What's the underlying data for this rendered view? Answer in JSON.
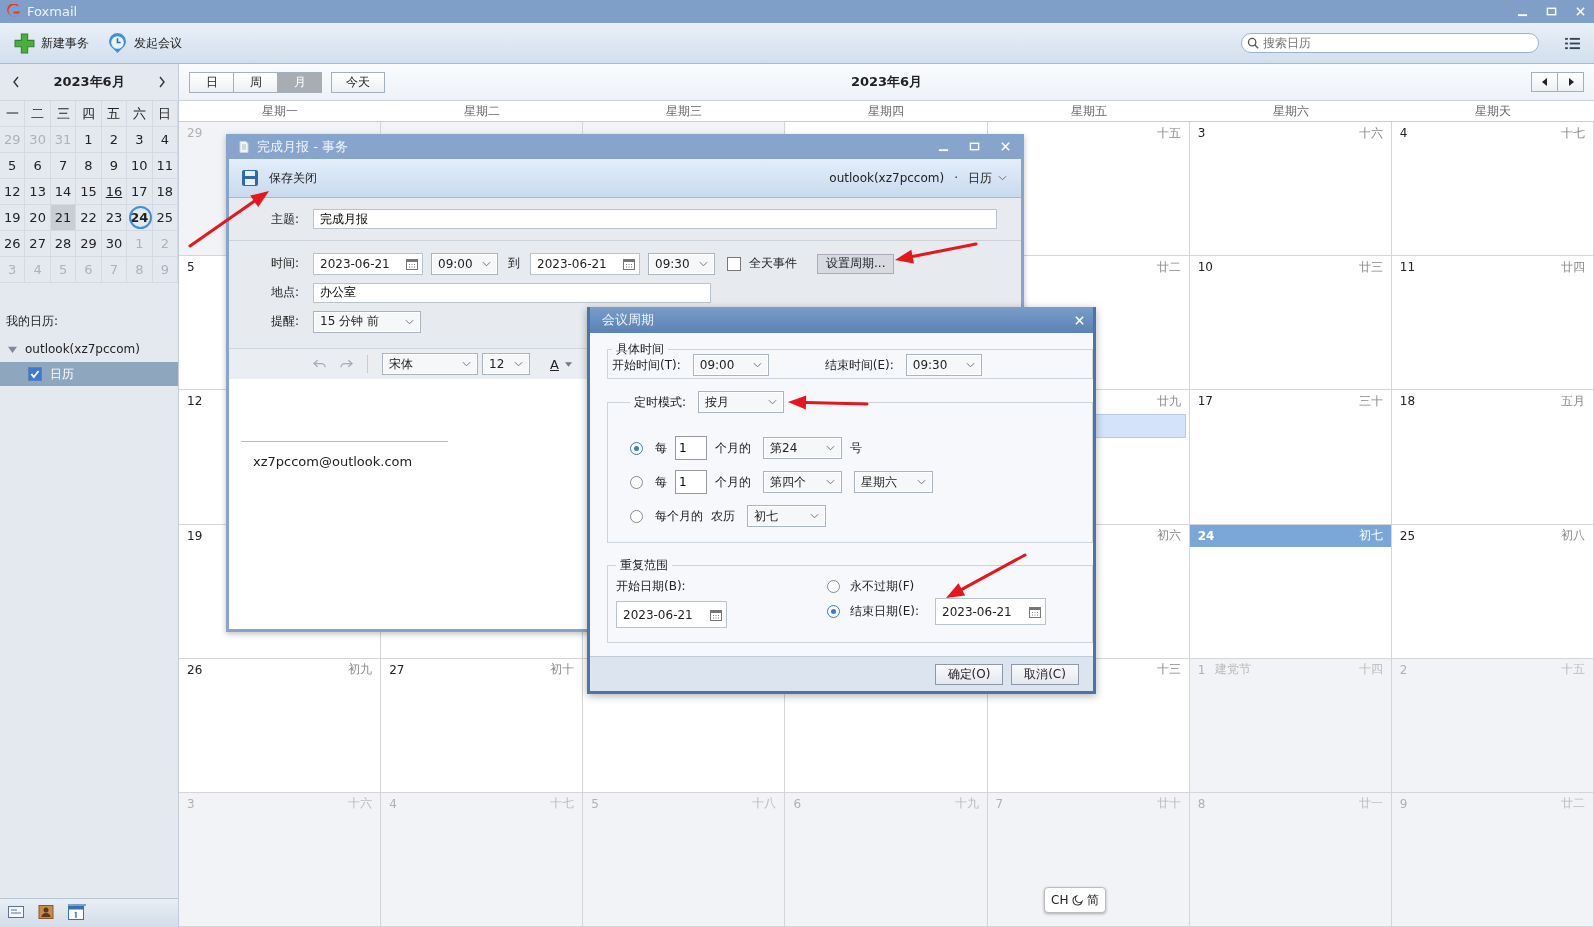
{
  "app": {
    "title": "Foxmail"
  },
  "toolbar": {
    "buttons": [
      {
        "kind": "new",
        "label": "新建事务"
      },
      {
        "kind": "meeting",
        "label": "发起会议"
      }
    ],
    "search": {
      "placeholder": "搜索日历"
    }
  },
  "mini_calendar": {
    "title": "2023年6月",
    "weekdays": [
      "一",
      "二",
      "三",
      "四",
      "五",
      "六",
      "日"
    ],
    "days": [
      {
        "d": "29",
        "other": true,
        "selected": false,
        "today": false,
        "event": false
      },
      {
        "d": "30",
        "other": true,
        "selected": false,
        "today": false,
        "event": false
      },
      {
        "d": "31",
        "other": true,
        "selected": false,
        "today": false,
        "event": false
      },
      {
        "d": "1",
        "other": false,
        "selected": false,
        "today": false,
        "event": false
      },
      {
        "d": "2",
        "other": false,
        "selected": false,
        "today": false,
        "event": false
      },
      {
        "d": "3",
        "other": false,
        "selected": false,
        "today": false,
        "event": false
      },
      {
        "d": "4",
        "other": false,
        "selected": false,
        "today": false,
        "event": false
      },
      {
        "d": "5",
        "other": false,
        "selected": false,
        "today": false,
        "event": false
      },
      {
        "d": "6",
        "other": false,
        "selected": false,
        "today": false,
        "event": false
      },
      {
        "d": "7",
        "other": false,
        "selected": false,
        "today": false,
        "event": false
      },
      {
        "d": "8",
        "other": false,
        "selected": false,
        "today": false,
        "event": false
      },
      {
        "d": "9",
        "other": false,
        "selected": false,
        "today": false,
        "event": false
      },
      {
        "d": "10",
        "other": false,
        "selected": false,
        "today": false,
        "event": false
      },
      {
        "d": "11",
        "other": false,
        "selected": false,
        "today": false,
        "event": false
      },
      {
        "d": "12",
        "other": false,
        "selected": false,
        "today": false,
        "event": false
      },
      {
        "d": "13",
        "other": false,
        "selected": false,
        "today": false,
        "event": false
      },
      {
        "d": "14",
        "other": false,
        "selected": false,
        "today": false,
        "event": false
      },
      {
        "d": "15",
        "other": false,
        "selected": false,
        "today": false,
        "event": false
      },
      {
        "d": "16",
        "other": false,
        "selected": false,
        "today": false,
        "event": true
      },
      {
        "d": "17",
        "other": false,
        "selected": false,
        "today": false,
        "event": false
      },
      {
        "d": "18",
        "other": false,
        "selected": false,
        "today": false,
        "event": false
      },
      {
        "d": "19",
        "other": false,
        "selected": false,
        "today": false,
        "event": false
      },
      {
        "d": "20",
        "other": false,
        "selected": false,
        "today": false,
        "event": false
      },
      {
        "d": "21",
        "other": false,
        "selected": true,
        "today": false,
        "event": false
      },
      {
        "d": "22",
        "other": false,
        "selected": false,
        "today": false,
        "event": false
      },
      {
        "d": "23",
        "other": false,
        "selected": false,
        "today": false,
        "event": false
      },
      {
        "d": "24",
        "other": false,
        "selected": false,
        "today": true,
        "event": false
      },
      {
        "d": "25",
        "other": false,
        "selected": false,
        "today": false,
        "event": false
      },
      {
        "d": "26",
        "other": false,
        "selected": false,
        "today": false,
        "event": false
      },
      {
        "d": "27",
        "other": false,
        "selected": false,
        "today": false,
        "event": false
      },
      {
        "d": "28",
        "other": false,
        "selected": false,
        "today": false,
        "event": false
      },
      {
        "d": "29",
        "other": false,
        "selected": false,
        "today": false,
        "event": false
      },
      {
        "d": "30",
        "other": false,
        "selected": false,
        "today": false,
        "event": false
      },
      {
        "d": "1",
        "other": true,
        "selected": false,
        "today": false,
        "event": false
      },
      {
        "d": "2",
        "other": true,
        "selected": false,
        "today": false,
        "event": false
      },
      {
        "d": "3",
        "other": true,
        "selected": false,
        "today": false,
        "event": false
      },
      {
        "d": "4",
        "other": true,
        "selected": false,
        "today": false,
        "event": false
      },
      {
        "d": "5",
        "other": true,
        "selected": false,
        "today": false,
        "event": false
      },
      {
        "d": "6",
        "other": true,
        "selected": false,
        "today": false,
        "event": false
      },
      {
        "d": "7",
        "other": true,
        "selected": false,
        "today": false,
        "event": false
      },
      {
        "d": "8",
        "other": true,
        "selected": false,
        "today": false,
        "event": false
      },
      {
        "d": "9",
        "other": true,
        "selected": false,
        "today": false,
        "event": false
      }
    ]
  },
  "my_calendars": {
    "heading": "我的日历:",
    "accounts": [
      {
        "name": "outlook(xz7pccom)",
        "expanded": true,
        "children": [
          {
            "name": "日历",
            "checked": true,
            "selected": true
          }
        ]
      }
    ]
  },
  "bottom_nav": [
    {
      "kind": "mail",
      "selected": false
    },
    {
      "kind": "contacts",
      "selected": false
    },
    {
      "kind": "calendar",
      "selected": true
    }
  ],
  "calendar": {
    "views": [
      {
        "label": "日",
        "selected": false
      },
      {
        "label": "周",
        "selected": false
      },
      {
        "label": "月",
        "selected": true
      }
    ],
    "today_button": "今天",
    "title": "2023年6月",
    "weekdays": [
      "星期一",
      "星期二",
      "星期三",
      "星期四",
      "星期五",
      "星期六",
      "星期天"
    ],
    "cells": [
      {
        "day": "29",
        "other_month": true,
        "today": false
      },
      {
        "other_month": true
      },
      {
        "other_month": true
      },
      {
        "other_month": false
      },
      {
        "lunar": "十五",
        "other_month": false,
        "today": false
      },
      {
        "day": "3",
        "lunar": "十六",
        "other_month": false,
        "today": false
      },
      {
        "day": "4",
        "lunar": "十七",
        "other_month": false,
        "today": false
      },
      {
        "day": "5",
        "other_month": false,
        "today": false
      },
      {},
      {},
      {},
      {
        "lunar": "廿二",
        "other_month": false,
        "today": false
      },
      {
        "day": "10",
        "lunar": "廿三",
        "other_month": false,
        "today": false
      },
      {
        "day": "11",
        "lunar": "廿四",
        "other_month": false,
        "today": false
      },
      {
        "day": "12",
        "other_month": false,
        "today": false
      },
      {},
      {},
      {},
      {
        "lunar": "廿九",
        "other_month": false,
        "today": false,
        "has_event": true
      },
      {
        "day": "17",
        "lunar": "三十",
        "other_month": false,
        "today": false
      },
      {
        "day": "18",
        "lunar": "五月",
        "other_month": false,
        "today": false
      },
      {
        "day": "19",
        "other_month": false,
        "today": false
      },
      {
        "other_month": false
      },
      {},
      {},
      {
        "lunar": "初六",
        "other_month": false,
        "today": false
      },
      {
        "day": "24",
        "lunar": "初七",
        "other_month": false,
        "today": true
      },
      {
        "day": "25",
        "lunar": "初八",
        "other_month": false,
        "today": false
      },
      {
        "day": "26",
        "lunar": "初九",
        "other_month": false,
        "today": false
      },
      {
        "day": "27",
        "lunar": "初十",
        "other_month": false,
        "today": false
      },
      {
        "other_month": false
      },
      {
        "other_month": false
      },
      {
        "lunar": "十三",
        "other_month": false,
        "today": false
      },
      {
        "day": "1",
        "holiday": "建党节",
        "lunar": "十四",
        "other_month": true,
        "today": false
      },
      {
        "day": "2",
        "lunar": "十五",
        "other_month": true,
        "today": false
      },
      {
        "day": "3",
        "lunar": "十六",
        "other_month": true,
        "today": false
      },
      {
        "day": "4",
        "lunar": "十七",
        "other_month": true,
        "today": false
      },
      {
        "day": "5",
        "lunar": "十八",
        "other_month": true,
        "today": false
      },
      {
        "day": "6",
        "lunar": "十九",
        "other_month": true,
        "today": false
      },
      {
        "day": "7",
        "lunar": "廿十",
        "other_month": true,
        "today": false
      },
      {
        "day": "8",
        "lunar": "廿一",
        "other_month": true,
        "today": false
      },
      {
        "day": "9",
        "lunar": "廿二",
        "other_month": true,
        "today": false
      }
    ]
  },
  "event_window": {
    "title": "完成月报 - 事务",
    "save_button": "保存关闭",
    "account": "outlook(xz7pccom)",
    "separator": "·",
    "calendar": "日历",
    "subject": {
      "label": "主题:",
      "value": "完成月报"
    },
    "time": {
      "label": "时间:",
      "start_date": "2023-06-21",
      "start_time": "09:00",
      "to": "到",
      "end_date": "2023-06-21",
      "end_time": "09:30"
    },
    "all_day": {
      "label": "全天事件",
      "checked": false
    },
    "recurrence_button": "设置周期...",
    "location": {
      "label": "地点:",
      "value": "办公室"
    },
    "reminder": {
      "label": "提醒:",
      "value": "15 分钟 前"
    },
    "editor": {
      "font": "宋体",
      "size": "12",
      "color_glyph": "A"
    },
    "signature": "xz7pccom@outlook.com"
  },
  "recurrence_dialog": {
    "title": "会议周期",
    "time_group": {
      "legend": "具体时间",
      "start_label": "开始时间(T):",
      "start": "09:00",
      "end_label": "结束时间(E):",
      "end": "09:30"
    },
    "mode_label": "定时模式:",
    "mode": "按月",
    "options": [
      {
        "kind": "day_of_month",
        "selected": true,
        "every": "每",
        "interval": "1",
        "unit": "个月的",
        "day": "第24",
        "suffix": "号"
      },
      {
        "kind": "weekday_of_month",
        "selected": false,
        "every": "每",
        "interval": "1",
        "unit": "个月的",
        "week": "第四个",
        "weekday": "星期六"
      },
      {
        "kind": "lunar",
        "selected": false,
        "text": "每个月的",
        "calendar": "农历",
        "lunar_day": "初七"
      }
    ],
    "range_group": {
      "legend": "重复范围",
      "start_label": "开始日期(B):",
      "start": "2023-06-21",
      "end_options": [
        {
          "kind": "never",
          "label": "永不过期(F)",
          "selected": false
        },
        {
          "kind": "end_date",
          "label": "结束日期(E):",
          "selected": true,
          "date": "2023-06-21"
        }
      ]
    },
    "buttons": [
      "确定(O)",
      "取消(C)"
    ]
  },
  "ime": {
    "lang": "CH",
    "mode": "简"
  }
}
